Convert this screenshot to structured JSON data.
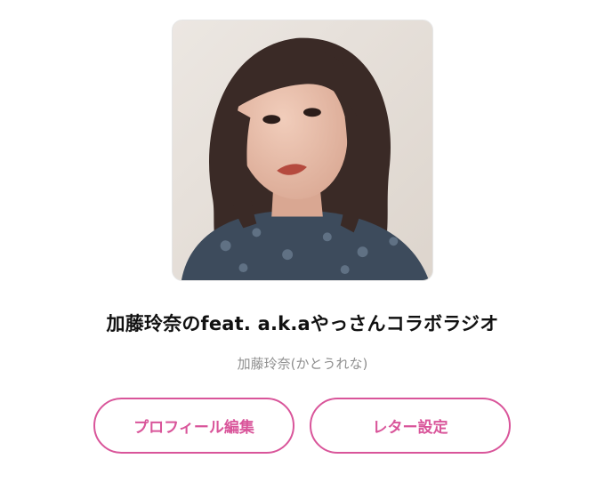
{
  "program": {
    "title": "加藤玲奈のfeat. a.k.aやっさんコラボラジオ",
    "host": "加藤玲奈(かとうれな)"
  },
  "actions": {
    "edit_profile_label": "プロフィール編集",
    "letter_settings_label": "レター設定"
  },
  "colors": {
    "accent": "#d9559a",
    "title_text": "#111111",
    "subtitle_text": "#8f8f8f"
  }
}
